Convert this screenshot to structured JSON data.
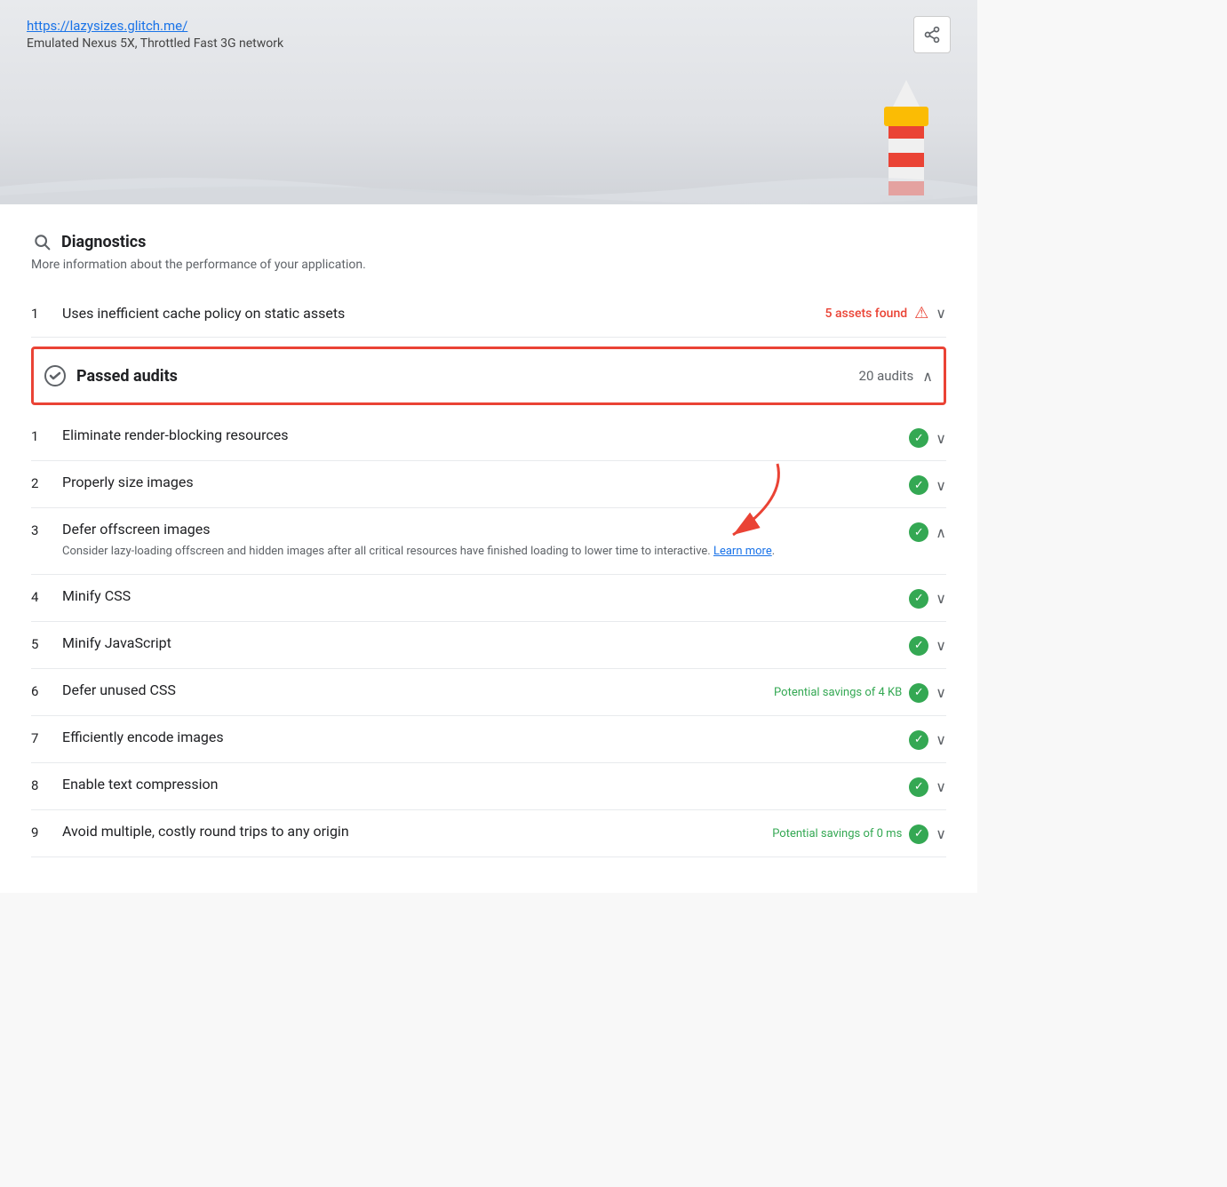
{
  "header": {
    "url": "https://lazysizes.glitch.me/",
    "subtitle": "Emulated Nexus 5X, Throttled Fast 3G network",
    "share_label": "Share"
  },
  "diagnostics": {
    "title": "Diagnostics",
    "description": "More information about the performance of your application.",
    "search_icon": "🔍",
    "items": [
      {
        "num": "1",
        "label": "Uses inefficient cache policy on static assets",
        "meta": "5 assets found",
        "meta_color": "#ea4335",
        "has_warning": true
      }
    ]
  },
  "passed_audits": {
    "title": "Passed audits",
    "count": "20 audits",
    "items": [
      {
        "num": "1",
        "label": "Eliminate render-blocking resources",
        "savings": "",
        "expanded": false
      },
      {
        "num": "2",
        "label": "Properly size images",
        "savings": "",
        "expanded": false
      },
      {
        "num": "3",
        "label": "Defer offscreen images",
        "savings": "",
        "expanded": true,
        "description": "Consider lazy-loading offscreen and hidden images after all critical resources have finished loading to lower time to interactive.",
        "learn_more": "Learn more"
      },
      {
        "num": "4",
        "label": "Minify CSS",
        "savings": "",
        "expanded": false
      },
      {
        "num": "5",
        "label": "Minify JavaScript",
        "savings": "",
        "expanded": false
      },
      {
        "num": "6",
        "label": "Defer unused CSS",
        "savings": "Potential savings of 4 KB",
        "expanded": false
      },
      {
        "num": "7",
        "label": "Efficiently encode images",
        "savings": "",
        "expanded": false
      },
      {
        "num": "8",
        "label": "Enable text compression",
        "savings": "",
        "expanded": false
      },
      {
        "num": "9",
        "label": "Avoid multiple, costly round trips to any origin",
        "savings": "Potential savings of 0 ms",
        "expanded": false
      }
    ]
  }
}
